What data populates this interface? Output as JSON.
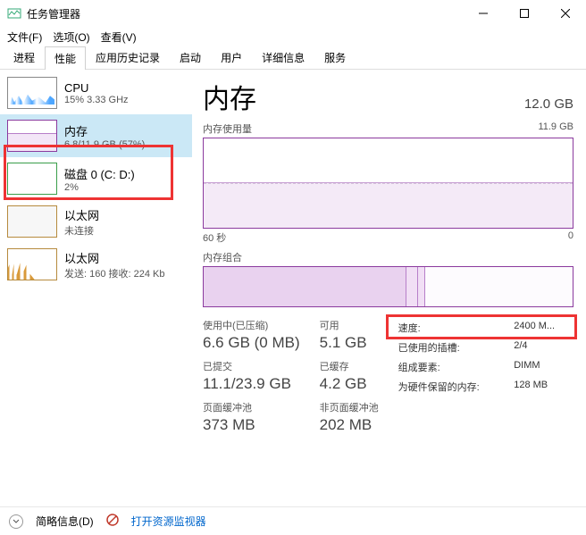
{
  "window": {
    "title": "任务管理器"
  },
  "menu": {
    "file": "文件(F)",
    "options": "选项(O)",
    "view": "查看(V)"
  },
  "tabs": [
    "进程",
    "性能",
    "应用历史记录",
    "启动",
    "用户",
    "详细信息",
    "服务"
  ],
  "activeTab": 1,
  "sidebar": {
    "items": [
      {
        "title": "CPU",
        "sub": "15% 3.33 GHz"
      },
      {
        "title": "内存",
        "sub": "6.8/11.9 GB (57%)"
      },
      {
        "title": "磁盘 0 (C: D:)",
        "sub": "2%"
      },
      {
        "title": "以太网",
        "sub": "未连接"
      },
      {
        "title": "以太网",
        "sub": "发送: 160 接收: 224 Kb"
      }
    ]
  },
  "main": {
    "title": "内存",
    "capacity": "12.0 GB",
    "usage_label": "内存使用量",
    "usage_scale_right": "11.9 GB",
    "x_left": "60 秒",
    "x_right": "0",
    "composition_label": "内存组合",
    "stats": {
      "in_use_lbl": "使用中(已压缩)",
      "in_use_val": "6.6 GB (0 MB)",
      "avail_lbl": "可用",
      "avail_val": "5.1 GB",
      "commit_lbl": "已提交",
      "commit_val": "11.1/23.9 GB",
      "cached_lbl": "已缓存",
      "cached_val": "4.2 GB",
      "paged_lbl": "页面缓冲池",
      "paged_val": "373 MB",
      "nonpaged_lbl": "非页面缓冲池",
      "nonpaged_val": "202 MB"
    },
    "right": {
      "speed_lbl": "速度:",
      "speed_val": "2400 M...",
      "slots_lbl": "已使用的插槽:",
      "slots_val": "2/4",
      "form_lbl": "组成要素:",
      "form_val": "DIMM",
      "reserved_lbl": "为硬件保留的内存:",
      "reserved_val": "128 MB"
    }
  },
  "footer": {
    "less": "简略信息(D)",
    "resmon": "打开资源监视器"
  },
  "chart_data": {
    "type": "area",
    "title": "内存使用量",
    "x": {
      "label_left": "60 秒",
      "label_right": "0",
      "range_seconds": [
        60,
        0
      ]
    },
    "ylim": [
      0,
      11.9
    ],
    "ylabel": "GB",
    "series": [
      {
        "name": "内存使用量",
        "approx_value_gb": 6.8,
        "percent": 57
      }
    ]
  }
}
